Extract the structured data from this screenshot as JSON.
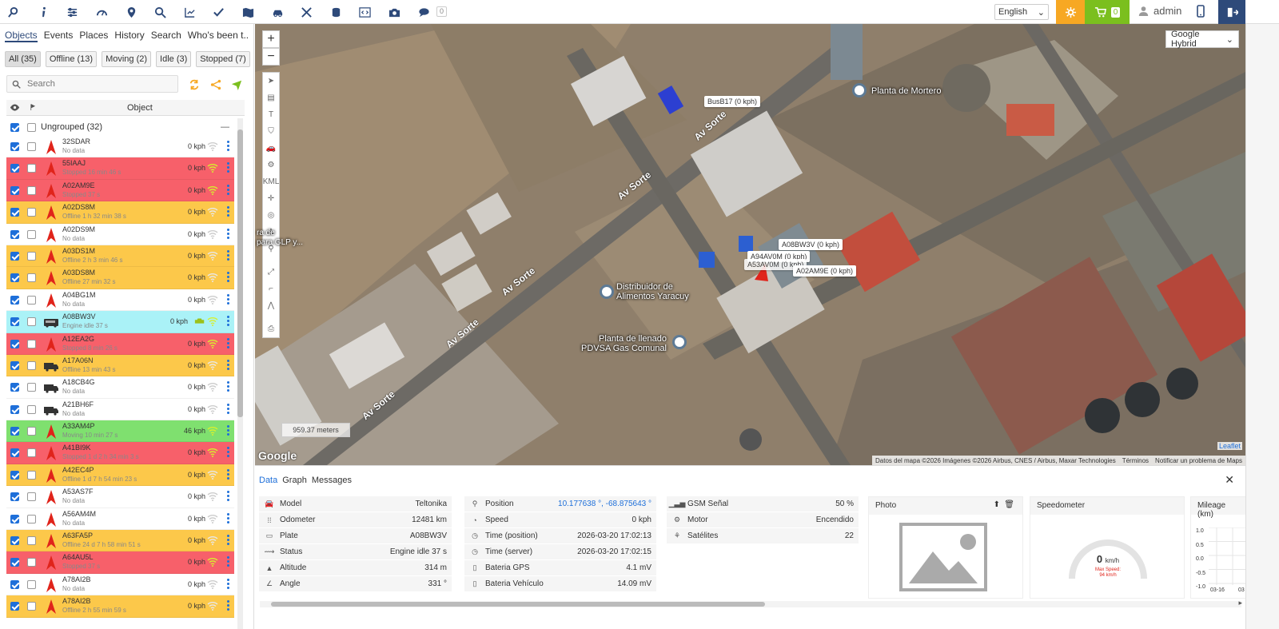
{
  "topbar": {
    "notifications_count": "0",
    "language": "English",
    "cart_count": "0",
    "username": "admin"
  },
  "left": {
    "tabs": [
      "Objects",
      "Events",
      "Places",
      "History",
      "Search",
      "Who's been t.."
    ],
    "filters": [
      "All (35)",
      "Offline (13)",
      "Moving (2)",
      "Idle (3)",
      "Stopped (7)"
    ],
    "search_placeholder": "Search",
    "header_object": "Object",
    "group_label": "Ungrouped (32)",
    "objects": [
      {
        "name": "32SDAR",
        "status": "No data",
        "speed": "0 kph",
        "bg": "#ffffff",
        "icon": "arrow"
      },
      {
        "name": "55IAAJ",
        "status": "Stopped 16 min 46 s",
        "speed": "0 kph",
        "bg": "#f7606a",
        "icon": "arrow"
      },
      {
        "name": "A02AM9E",
        "status": "Stopped 37 s",
        "speed": "0 kph",
        "bg": "#f7606a",
        "icon": "arrow"
      },
      {
        "name": "A02DS8M",
        "status": "Offline 1 h 32 min 38 s",
        "speed": "0 kph",
        "bg": "#fcc84a",
        "icon": "arrow"
      },
      {
        "name": "A02DS9M",
        "status": "No data",
        "speed": "0 kph",
        "bg": "#ffffff",
        "icon": "arrow"
      },
      {
        "name": "A03DS1M",
        "status": "Offline 2 h 3 min 46 s",
        "speed": "0 kph",
        "bg": "#fcc84a",
        "icon": "arrow"
      },
      {
        "name": "A03DS8M",
        "status": "Offline 27 min 32 s",
        "speed": "0 kph",
        "bg": "#fcc84a",
        "icon": "arrow"
      },
      {
        "name": "A04BG1M",
        "status": "No data",
        "speed": "0 kph",
        "bg": "#ffffff",
        "icon": "arrow"
      },
      {
        "name": "A08BW3V",
        "status": "Engine idle 37 s",
        "speed": "0 kph",
        "bg": "#aaf2f7",
        "icon": "bus"
      },
      {
        "name": "A12EA2G",
        "status": "Stopped 8 min 26 s",
        "speed": "0 kph",
        "bg": "#f7606a",
        "icon": "arrow"
      },
      {
        "name": "A17A06N",
        "status": "Offline 13 min 43 s",
        "speed": "0 kph",
        "bg": "#fcc84a",
        "icon": "truck"
      },
      {
        "name": "A18CB4G",
        "status": "No data",
        "speed": "0 kph",
        "bg": "#ffffff",
        "icon": "truck"
      },
      {
        "name": "A21BH6F",
        "status": "No data",
        "speed": "0 kph",
        "bg": "#ffffff",
        "icon": "truck"
      },
      {
        "name": "A33AM4P",
        "status": "Moving 10 min 27 s",
        "speed": "46 kph",
        "bg": "#7fe06f",
        "icon": "arrow"
      },
      {
        "name": "A41BI9K",
        "status": "Stopped 1 d 2 h 34 min 3 s",
        "speed": "0 kph",
        "bg": "#f7606a",
        "icon": "arrow"
      },
      {
        "name": "A42EC4P",
        "status": "Offline 1 d 7 h 54 min 23 s",
        "speed": "0 kph",
        "bg": "#fcc84a",
        "icon": "arrow"
      },
      {
        "name": "A53AS7F",
        "status": "No data",
        "speed": "0 kph",
        "bg": "#ffffff",
        "icon": "arrow"
      },
      {
        "name": "A56AM4M",
        "status": "No data",
        "speed": "0 kph",
        "bg": "#ffffff",
        "icon": "arrow"
      },
      {
        "name": "A63FA5P",
        "status": "Offline 24 d 7 h 58 min 51 s",
        "speed": "0 kph",
        "bg": "#fcc84a",
        "icon": "arrow"
      },
      {
        "name": "A64AU5L",
        "status": "Stopped 37 s",
        "speed": "0 kph",
        "bg": "#f7606a",
        "icon": "arrow"
      },
      {
        "name": "A78AI2B",
        "status": "No data",
        "speed": "0 kph",
        "bg": "#ffffff",
        "icon": "arrow"
      },
      {
        "name": "A78AI2B",
        "status": "Offline 2 h 55 min 59 s",
        "speed": "0 kph",
        "bg": "#fcc84a",
        "icon": "arrow"
      }
    ]
  },
  "map": {
    "map_type": "Google Hybrid",
    "labels": {
      "bus17": "BusB17 (0 kph)",
      "a08": "A08BW3V (0 kph)",
      "a94": "A94AV0M (0 kph)",
      "a53": "A53AV0M (0 kph)",
      "a02": "A02AM9E (0 kph)"
    },
    "poi": {
      "mortero": "Planta de Mortero",
      "distribuidor": "Distribuidor de\nAlimentos Yaracuy",
      "llenado": "Planta de llenado\nPDVSA Gas Comunal",
      "glp": "ra de\npara GLP y..."
    },
    "roads": {
      "r1": "Av Sorte",
      "r2": "Av Sorte",
      "r3": "Av Sorte",
      "r4": "Av Sorte",
      "r5": "Av Sorte"
    },
    "scale": "959.37 meters",
    "google": "Google",
    "attribution": "Datos del mapa ©2026 Imágenes ©2026 Airbus, CNES / Airbus, Maxar Technologies",
    "terms": "Términos",
    "report": "Notificar un problema de Maps",
    "leaflet": "Leaflet"
  },
  "bottom": {
    "tabs": [
      "Data",
      "Graph",
      "Messages"
    ],
    "col1": [
      {
        "label": "Model",
        "value": "Teltonika"
      },
      {
        "label": "Odometer",
        "value": "12481 km"
      },
      {
        "label": "Plate",
        "value": "A08BW3V"
      },
      {
        "label": "Status",
        "value": "Engine idle 37 s"
      },
      {
        "label": "Altitude",
        "value": "314 m"
      },
      {
        "label": "Angle",
        "value": "331 °"
      }
    ],
    "col2": [
      {
        "label": "Position",
        "value": "10.177638 °, -68.875643 °"
      },
      {
        "label": "Speed",
        "value": "0 kph"
      },
      {
        "label": "Time (position)",
        "value": "2026-03-20 17:02:13"
      },
      {
        "label": "Time (server)",
        "value": "2026-03-20 17:02:15"
      },
      {
        "label": "Bateria GPS",
        "value": "4.1 mV"
      },
      {
        "label": "Bateria Vehículo",
        "value": "14.09 mV"
      }
    ],
    "col3": [
      {
        "label": "GSM Señal",
        "value": "50 %"
      },
      {
        "label": "Motor",
        "value": "Encendido"
      },
      {
        "label": "Satélites",
        "value": "22"
      }
    ],
    "photo_title": "Photo",
    "speedometer_title": "Speedometer",
    "speed_value": "0",
    "speed_unit": "km/h",
    "max_speed_label": "Max Speed:",
    "max_speed_value": "94 km/h",
    "mileage_title": "Mileage (km)",
    "mileage_yticks": [
      "1.0",
      "0.5",
      "0.0",
      "-0.5",
      "-1.0"
    ],
    "mileage_xtick": "03-16",
    "mileage_xtick2": "03"
  }
}
